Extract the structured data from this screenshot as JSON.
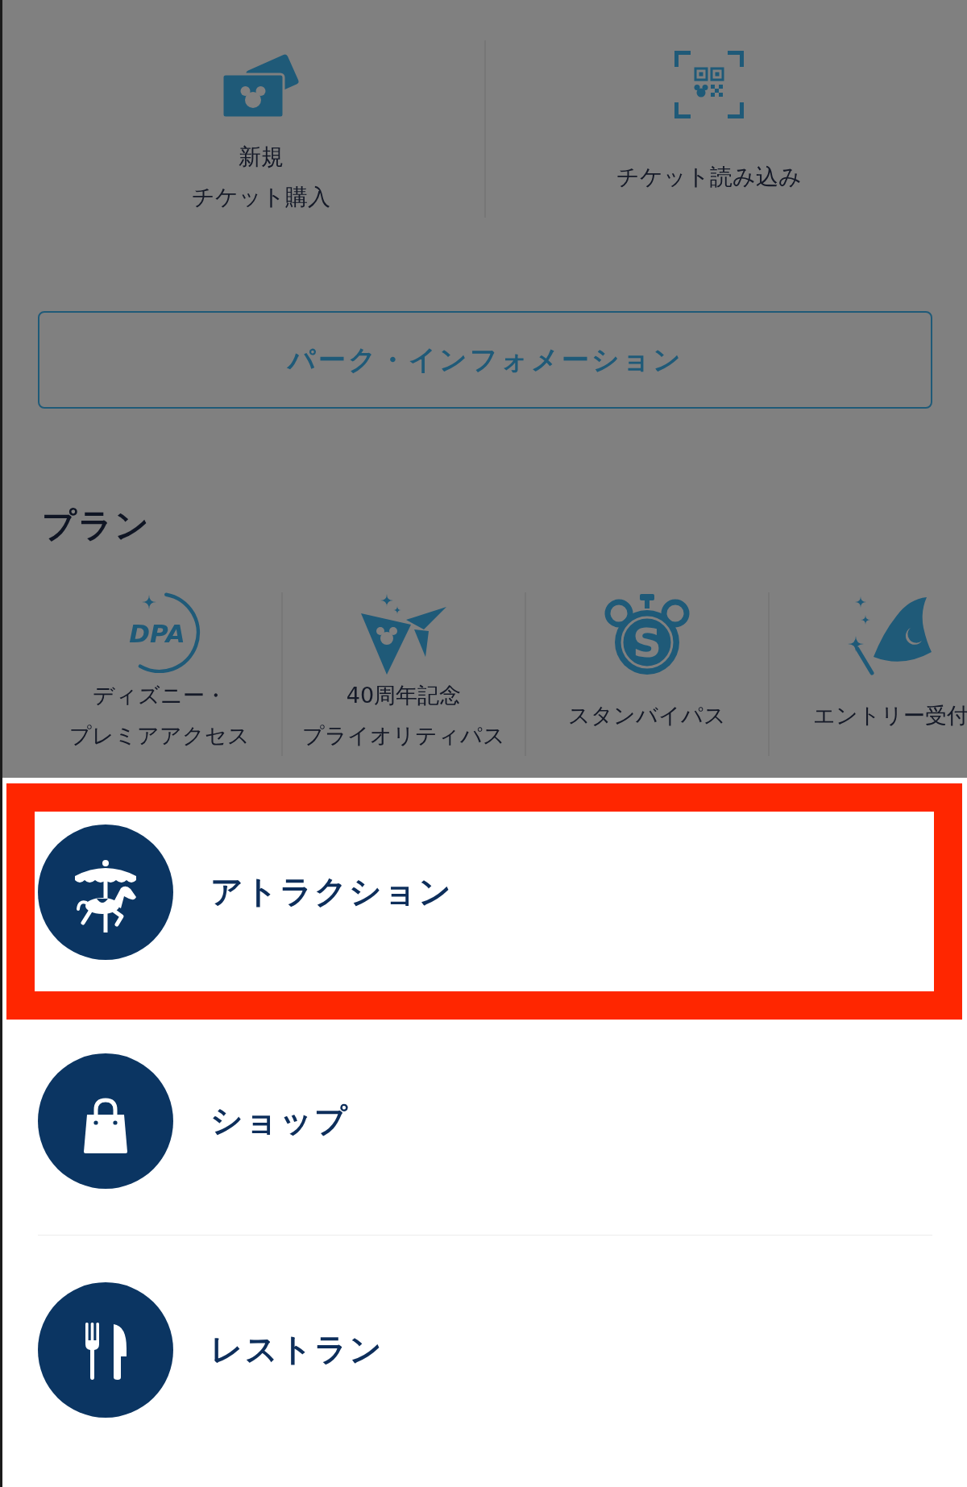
{
  "background_screen": {
    "dimmed": true,
    "ticket_actions": [
      {
        "kind": "buy",
        "label_lines": [
          "新規",
          "チケット購入"
        ]
      },
      {
        "kind": "scan",
        "label_lines": [
          "チケット読み込み"
        ]
      }
    ],
    "park_info_button": {
      "label": "パーク・インフォメーション"
    },
    "plan_section": {
      "title": "プラン",
      "items": [
        {
          "kind": "dpa",
          "logo_text": "DPA",
          "label_lines": [
            "ディズニー・",
            "プレミアアクセス"
          ]
        },
        {
          "kind": "priority_pass",
          "label_lines": [
            "40周年記念",
            "プライオリティパス"
          ]
        },
        {
          "kind": "standby_pass",
          "logo_text": "S",
          "label_lines": [
            "スタンバイパス"
          ]
        },
        {
          "kind": "entry",
          "label_lines": [
            "エントリー受付"
          ]
        }
      ]
    }
  },
  "category_sheet": {
    "items": [
      {
        "kind": "attraction",
        "label": "アトラクション",
        "highlighted": true
      },
      {
        "kind": "shop",
        "label": "ショップ",
        "highlighted": false
      },
      {
        "kind": "restaurant",
        "label": "レストラン",
        "highlighted": false
      }
    ]
  }
}
